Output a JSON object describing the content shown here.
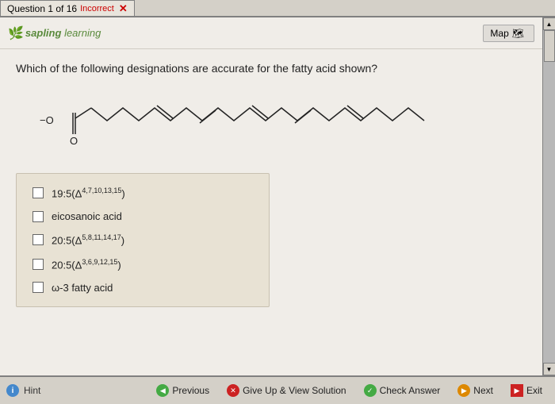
{
  "tab": {
    "question_label": "Question 1 of 16",
    "status_label": "Incorrect",
    "close_symbol": "✕"
  },
  "header": {
    "logo_top": "sapling",
    "logo_bottom": "learning",
    "map_button": "Map"
  },
  "question": {
    "text": "Which of the following designations are accurate for the fatty acid shown?"
  },
  "choices": [
    {
      "id": "c1",
      "html_label": "19:5(Δ⁴·⁷·¹⁰·¹³·¹⁵)"
    },
    {
      "id": "c2",
      "html_label": "eicosanoic acid"
    },
    {
      "id": "c3",
      "html_label": "20:5(Δ⁵·⁸·¹¹·¹⁴·¹⁷)"
    },
    {
      "id": "c4",
      "html_label": "20:5(Δ³·⁶·⁹·¹²·¹⁵)"
    },
    {
      "id": "c5",
      "html_label": "ω-3 fatty acid"
    }
  ],
  "bottom": {
    "hint_label": "Hint",
    "previous_label": "Previous",
    "giveup_label": "Give Up & View Solution",
    "check_label": "Check Answer",
    "next_label": "Next",
    "exit_label": "Exit"
  }
}
